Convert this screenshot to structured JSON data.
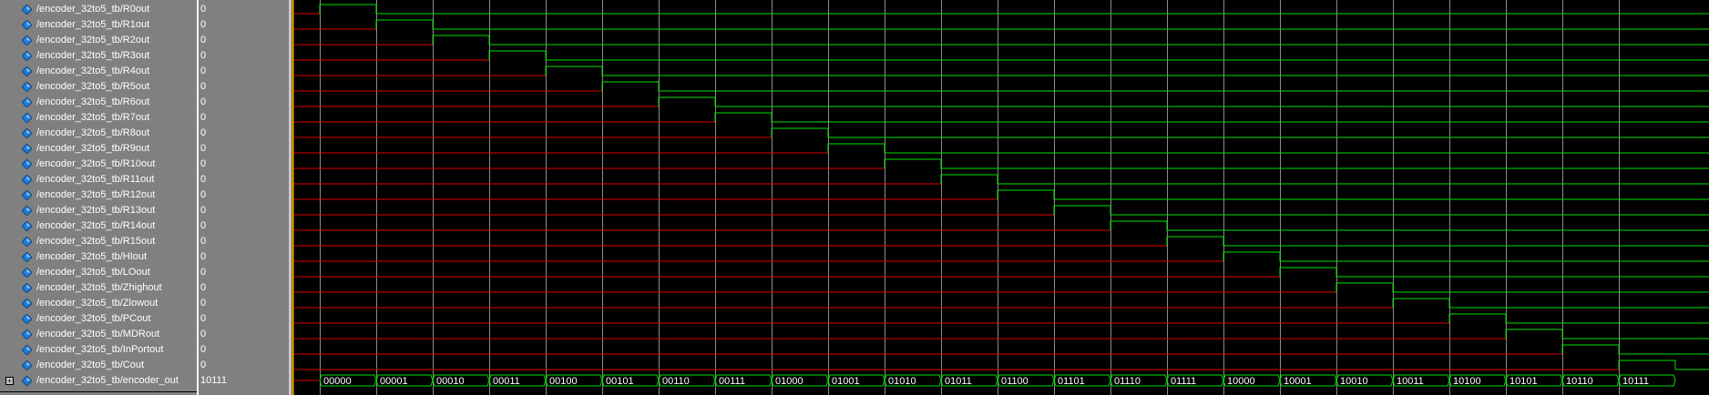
{
  "window": {
    "title": ""
  },
  "signals": [
    {
      "name": "/encoder_32to5_tb/R0out",
      "value": "0"
    },
    {
      "name": "/encoder_32to5_tb/R1out",
      "value": "0"
    },
    {
      "name": "/encoder_32to5_tb/R2out",
      "value": "0"
    },
    {
      "name": "/encoder_32to5_tb/R3out",
      "value": "0"
    },
    {
      "name": "/encoder_32to5_tb/R4out",
      "value": "0"
    },
    {
      "name": "/encoder_32to5_tb/R5out",
      "value": "0"
    },
    {
      "name": "/encoder_32to5_tb/R6out",
      "value": "0"
    },
    {
      "name": "/encoder_32to5_tb/R7out",
      "value": "0"
    },
    {
      "name": "/encoder_32to5_tb/R8out",
      "value": "0"
    },
    {
      "name": "/encoder_32to5_tb/R9out",
      "value": "0"
    },
    {
      "name": "/encoder_32to5_tb/R10out",
      "value": "0"
    },
    {
      "name": "/encoder_32to5_tb/R11out",
      "value": "0"
    },
    {
      "name": "/encoder_32to5_tb/R12out",
      "value": "0"
    },
    {
      "name": "/encoder_32to5_tb/R13out",
      "value": "0"
    },
    {
      "name": "/encoder_32to5_tb/R14out",
      "value": "0"
    },
    {
      "name": "/encoder_32to5_tb/R15out",
      "value": "0"
    },
    {
      "name": "/encoder_32to5_tb/HIout",
      "value": "0"
    },
    {
      "name": "/encoder_32to5_tb/LOout",
      "value": "0"
    },
    {
      "name": "/encoder_32to5_tb/Zhighout",
      "value": "0"
    },
    {
      "name": "/encoder_32to5_tb/Zlowout",
      "value": "0"
    },
    {
      "name": "/encoder_32to5_tb/PCout",
      "value": "0"
    },
    {
      "name": "/encoder_32to5_tb/MDRout",
      "value": "0"
    },
    {
      "name": "/encoder_32to5_tb/InPortout",
      "value": "0"
    },
    {
      "name": "/encoder_32to5_tb/Cout",
      "value": "0"
    },
    {
      "name": "/encoder_32to5_tb/encoder_out",
      "value": "10111",
      "expandable": true,
      "expand_symbol": "+"
    }
  ],
  "bus_values": [
    "00000",
    "00001",
    "00010",
    "00011",
    "00100",
    "00101",
    "00110",
    "00111",
    "01000",
    "01001",
    "01010",
    "01011",
    "01100",
    "01101",
    "01110",
    "01111",
    "10000",
    "10001",
    "10010",
    "10011",
    "10100",
    "10101",
    "10110",
    "10111"
  ],
  "colors": {
    "high": "#00e000",
    "low": "#e00000",
    "grid": "#b0b0b0",
    "cursor": "#ffb000",
    "icon": "#1e7bd6",
    "background": "#000000"
  }
}
